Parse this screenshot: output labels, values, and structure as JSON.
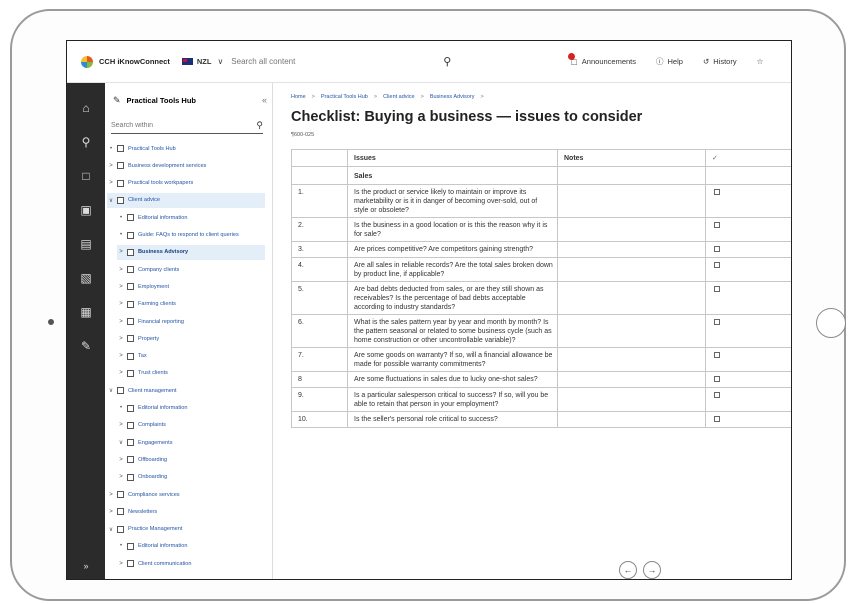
{
  "topbar": {
    "brand": "CCH iKnowConnect",
    "region": "NZL",
    "search_placeholder": "Search all content",
    "announcements": "Announcements",
    "help": "Help",
    "history": "History"
  },
  "sidebar": {
    "title": "Practical Tools Hub",
    "search_placeholder": "Search within",
    "items": [
      {
        "marker": "•",
        "label": "Practical Tools Hub",
        "level": 0
      },
      {
        "marker": ">",
        "label": "Business development services",
        "level": 0
      },
      {
        "marker": ">",
        "label": "Practical tools workpapers",
        "level": 0
      },
      {
        "marker": "∨",
        "label": "Client advice",
        "level": 0,
        "selected": true
      },
      {
        "marker": "•",
        "label": "Editorial information",
        "level": 1
      },
      {
        "marker": "•",
        "label": "Guide: FAQs to respond to client queries",
        "level": 1
      },
      {
        "marker": ">",
        "label": "Business Advisory",
        "level": 1,
        "bold": true,
        "selected": true
      },
      {
        "marker": ">",
        "label": "Company clients",
        "level": 1
      },
      {
        "marker": ">",
        "label": "Employment",
        "level": 1
      },
      {
        "marker": ">",
        "label": "Farming clients",
        "level": 1
      },
      {
        "marker": ">",
        "label": "Financial reporting",
        "level": 1
      },
      {
        "marker": ">",
        "label": "Property",
        "level": 1
      },
      {
        "marker": ">",
        "label": "Tax",
        "level": 1
      },
      {
        "marker": ">",
        "label": "Trust clients",
        "level": 1
      },
      {
        "marker": "∨",
        "label": "Client management",
        "level": 0
      },
      {
        "marker": "•",
        "label": "Editorial information",
        "level": 1
      },
      {
        "marker": ">",
        "label": "Complaints",
        "level": 1
      },
      {
        "marker": "∨",
        "label": "Engagements",
        "level": 1
      },
      {
        "marker": ">",
        "label": "Offboarding",
        "level": 1
      },
      {
        "marker": ">",
        "label": "Onboarding",
        "level": 1
      },
      {
        "marker": ">",
        "label": "Compliance services",
        "level": 0
      },
      {
        "marker": ">",
        "label": "Newsletters",
        "level": 0
      },
      {
        "marker": "∨",
        "label": "Practice Management",
        "level": 0
      },
      {
        "marker": "•",
        "label": "Editorial information",
        "level": 1
      },
      {
        "marker": ">",
        "label": "Client communication",
        "level": 1
      }
    ]
  },
  "breadcrumb": [
    "Home",
    "Practical Tools Hub",
    "Client advice",
    "Business Advisory"
  ],
  "page": {
    "title": "Checklist: Buying a business — issues to consider",
    "ref": "¶600-025"
  },
  "table": {
    "headers": {
      "issues": "Issues",
      "notes": "Notes",
      "check": "✓"
    },
    "section": "Sales",
    "rows": [
      {
        "num": "1.",
        "text": "Is the product or service likely to maintain or improve its marketability or is it in danger of becoming over-sold, out of style or obsolete?"
      },
      {
        "num": "2.",
        "text": "Is the business in a good location or is this the reason why it is for sale?"
      },
      {
        "num": "3.",
        "text": "Are prices competitive? Are competitors gaining strength?"
      },
      {
        "num": "4.",
        "text": "Are all sales in reliable records? Are the total sales broken down by product line, if applicable?"
      },
      {
        "num": "5.",
        "text": "Are bad debts deducted from sales, or are they still shown as receivables? Is the percentage of bad debts acceptable according to industry standards?"
      },
      {
        "num": "6.",
        "text": "What is the sales pattern year by year and month by month? Is the pattern seasonal or related to some business cycle (such as home construction or other uncontrollable variable)?"
      },
      {
        "num": "7.",
        "text": "Are some goods on warranty? If so, will a financial allowance be made for possible warranty commitments?"
      },
      {
        "num": "8",
        "text": "Are some fluctuations in sales due to lucky one-shot sales?"
      },
      {
        "num": "9.",
        "text": "Is a particular salesperson critical to success? If so, will you be able to retain that person in your employment?"
      },
      {
        "num": "10.",
        "text": "Is the seller's personal role critical to success?"
      }
    ]
  }
}
